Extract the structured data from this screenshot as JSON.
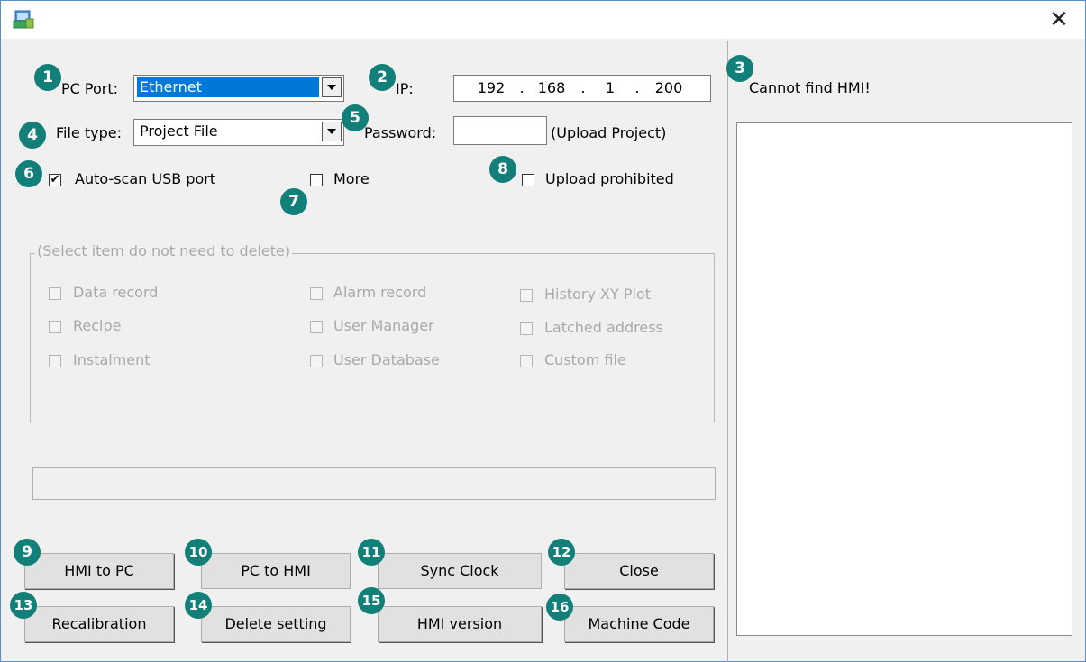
{
  "titlebar": {
    "close_symbol": "✕"
  },
  "pc_port": {
    "label": "PC Port:",
    "value": "Ethernet"
  },
  "ip": {
    "label": "IP:",
    "octets": [
      "192",
      "168",
      "1",
      "200"
    ],
    "dot": "."
  },
  "status": {
    "text": "Cannot find HMI!"
  },
  "file_type": {
    "label": "File type:",
    "value": "Project File"
  },
  "password": {
    "label": "Password:",
    "value": "",
    "hint": "(Upload Project)"
  },
  "options": {
    "auto_scan": {
      "label": "Auto-scan USB port",
      "checked": true
    },
    "more": {
      "label": "More",
      "checked": false
    },
    "upload_prohibited": {
      "label": "Upload prohibited",
      "checked": false
    }
  },
  "delete_group": {
    "title": "(Select item do not need to delete)",
    "items": [
      "Data record",
      "Alarm record",
      "History XY Plot",
      "Recipe",
      "User Manager",
      "Latched address",
      "Instalment",
      "User Database",
      "Custom file"
    ]
  },
  "buttons": {
    "hmi_to_pc": "HMI to PC",
    "pc_to_hmi": "PC to HMI",
    "sync_clock": "Sync Clock",
    "close": "Close",
    "recalibration": "Recalibration",
    "delete_setting": "Delete setting",
    "hmi_version": "HMI version",
    "machine_code": "Machine Code"
  },
  "badges": [
    "1",
    "2",
    "3",
    "4",
    "5",
    "6",
    "7",
    "8",
    "9",
    "10",
    "11",
    "12",
    "13",
    "14",
    "15",
    "16"
  ],
  "colors": {
    "badge": "#127f78",
    "selection": "#0078d7",
    "window_bg": "#f0f0f0"
  },
  "checkmark": "✔"
}
